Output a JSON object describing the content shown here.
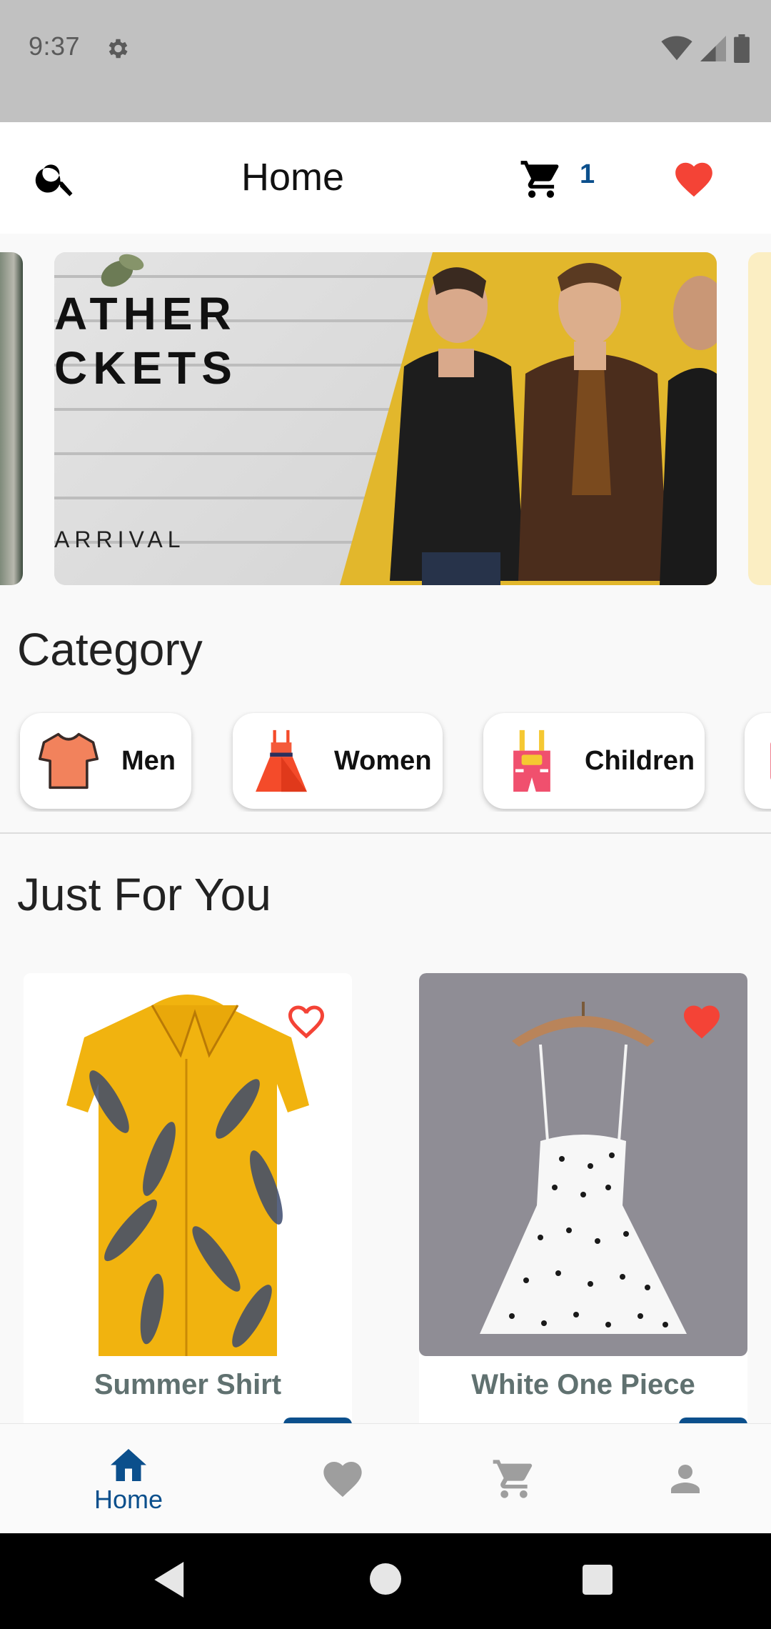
{
  "status_bar": {
    "time": "9:37",
    "settings_icon": "gear-icon",
    "wifi_icon": "wifi-icon",
    "signal_icon": "signal-icon",
    "battery_icon": "battery-icon"
  },
  "app_bar": {
    "title": "Home",
    "search_icon": "search-icon",
    "cart_icon": "cart-icon",
    "cart_count": "1",
    "favorite_icon": "heart-icon"
  },
  "banner": {
    "line1": "ATHER",
    "line2": "CKETS",
    "line3": "ARRIVAL"
  },
  "category": {
    "title": "Category",
    "items": [
      {
        "label": "Men",
        "icon": "tshirt-icon"
      },
      {
        "label": "Women",
        "icon": "dress-icon"
      },
      {
        "label": "Children",
        "icon": "overalls-icon"
      }
    ]
  },
  "just_for_you": {
    "title": "Just For You",
    "products": [
      {
        "name": "Summer Shirt",
        "favorited": false
      },
      {
        "name": "White One Piece",
        "favorited": true
      }
    ]
  },
  "bottom_nav": {
    "items": [
      {
        "label": "Home",
        "icon": "home-icon",
        "active": true
      },
      {
        "label": "",
        "icon": "heart-icon",
        "active": false
      },
      {
        "label": "",
        "icon": "cart-icon",
        "active": false
      },
      {
        "label": "",
        "icon": "person-icon",
        "active": false
      }
    ]
  },
  "colors": {
    "accent": "#0b4f8c",
    "heart": "#f44336",
    "status_bar": "#c1c1c1",
    "product_name": "#607170"
  }
}
